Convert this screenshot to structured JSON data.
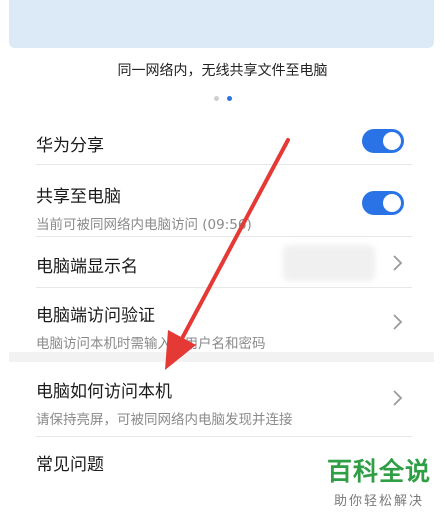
{
  "caption": "同一网络内，无线共享文件至电脑",
  "rows": {
    "huawei_share": {
      "title": "华为分享",
      "enabled": true
    },
    "share_to_pc": {
      "title": "共享至电脑",
      "subtitle": "当前可被同网络内电脑访问 (09:56)",
      "enabled": true
    },
    "pc_display_name": {
      "title": "电脑端显示名"
    },
    "pc_access_verify": {
      "title": "电脑端访问验证",
      "subtitle": "电脑访问本机时需输入的用户名和密码"
    },
    "how_pc_access": {
      "title": "电脑如何访问本机",
      "subtitle": "请保持亮屏，可被同网络内电脑发现并连接"
    },
    "faq": {
      "title": "常见问题"
    }
  },
  "watermark": {
    "title": "百科全说",
    "subtitle": "助你轻松解决"
  },
  "colors": {
    "accent": "#2a73e6",
    "arrow": "#e53935",
    "watermark": "#2f9e44"
  },
  "icons": {
    "chevron": "chevron-right-icon",
    "toggle": "toggle-switch"
  }
}
